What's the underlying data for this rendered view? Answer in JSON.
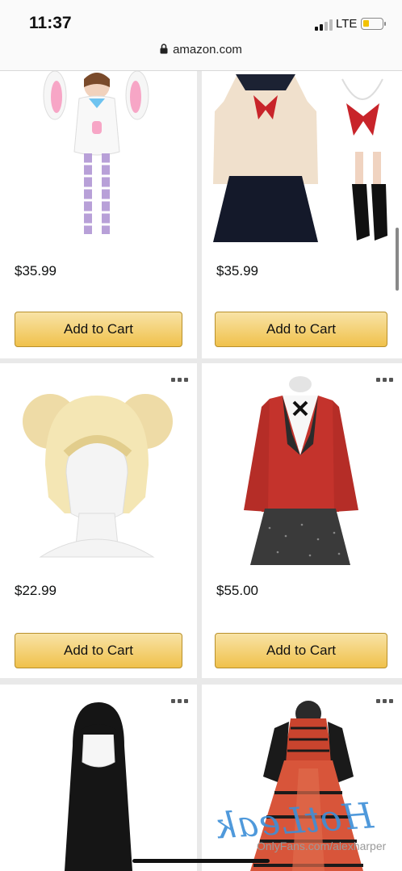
{
  "status_bar": {
    "time": "11:37",
    "carrier": "LTE",
    "battery_level": 0.35,
    "signal_bars": 2
  },
  "browser": {
    "url": "amazon.com"
  },
  "products": [
    {
      "price": "$35.99",
      "cta": "Add to Cart",
      "image": "bunny-hoodie-costume"
    },
    {
      "price": "$35.99",
      "cta": "Add to Cart",
      "image": "sailor-school-uniform"
    },
    {
      "price": "$22.99",
      "cta": "Add to Cart",
      "image": "blonde-buns-wig"
    },
    {
      "price": "$55.00",
      "cta": "Add to Cart",
      "image": "red-blazer-uniform"
    },
    {
      "image": "black-long-wig"
    },
    {
      "image": "gothic-lolita-dress"
    }
  ],
  "watermark": {
    "logo": "HotLeak",
    "text": "OnlyFans.com/alexharper"
  },
  "colors": {
    "button_top": "#f8e3a6",
    "button_bottom": "#f0c14b",
    "page_bg": "#e9e9e9"
  }
}
